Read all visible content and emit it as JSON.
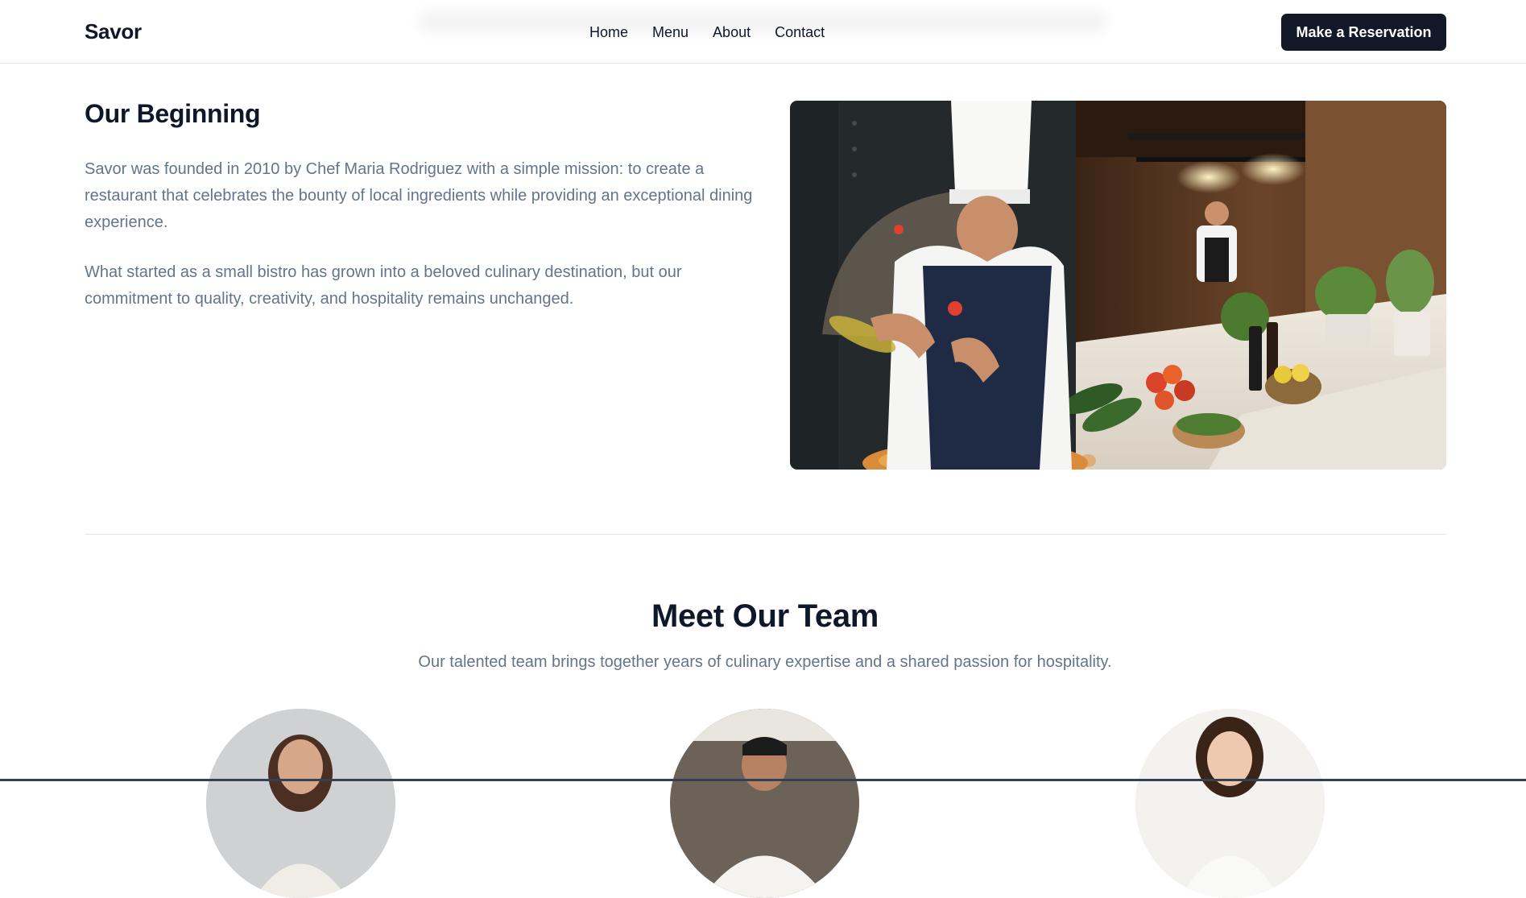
{
  "header": {
    "brand": "Savor",
    "nav": [
      "Home",
      "Menu",
      "About",
      "Contact"
    ],
    "cta_label": "Make a Reservation"
  },
  "story": {
    "heading": "Our Beginning",
    "paragraphs": [
      "Savor was founded in 2010 by Chef Maria Rodriguez with a simple mission: to create a restaurant that celebrates the bounty of local ingredients while providing an exceptional dining experience.",
      "What started as a small bistro has grown into a beloved culinary destination, but our commitment to quality, creativity, and hospitality remains unchanged."
    ],
    "image_name": "kitchen-chef-photo"
  },
  "team": {
    "heading": "Meet Our Team",
    "subtitle": "Our talented team brings together years of culinary expertise and a shared passion for hospitality.",
    "members": [
      {
        "image_name": "team-member-1-photo"
      },
      {
        "image_name": "team-member-2-photo"
      },
      {
        "image_name": "team-member-3-photo"
      }
    ]
  },
  "colors": {
    "primary_dark": "#111827",
    "heading_text": "#0f172a",
    "body_text": "#64748b",
    "divider": "#e2e8f0"
  }
}
